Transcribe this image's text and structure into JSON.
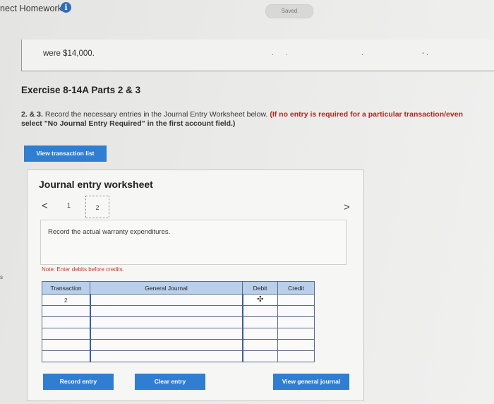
{
  "header": {
    "title": "nect Homework",
    "saved_label": "Saved"
  },
  "previous": {
    "text": "were $14,000."
  },
  "exercise": {
    "title": "Exercise 8-14A Parts 2 & 3",
    "instruction_lead": "2. & 3.",
    "instruction_main": " Record the necessary entries in the Journal Entry Worksheet below. ",
    "instruction_red": "(If no entry is required for a particular transaction/even",
    "instruction_line2": "select \"No Journal Entry Required\" in the first account field.)"
  },
  "view_transaction_label": "View transaction list",
  "worksheet": {
    "title": "Journal entry worksheet",
    "pages": [
      "1",
      "2"
    ],
    "current_page": "2",
    "prompt": "Record the actual warranty expenditures.",
    "note": "Note: Enter debits before credits.",
    "table": {
      "headers": [
        "Transaction",
        "General Journal",
        "Debit",
        "Credit"
      ],
      "rows": [
        {
          "transaction": "2",
          "account": "",
          "debit": "",
          "credit": ""
        },
        {
          "transaction": "",
          "account": "",
          "debit": "",
          "credit": ""
        },
        {
          "transaction": "",
          "account": "",
          "debit": "",
          "credit": ""
        },
        {
          "transaction": "",
          "account": "",
          "debit": "",
          "credit": ""
        },
        {
          "transaction": "",
          "account": "",
          "debit": "",
          "credit": ""
        },
        {
          "transaction": "",
          "account": "",
          "debit": "",
          "credit": ""
        }
      ]
    },
    "buttons": {
      "record": "Record entry",
      "clear": "Clear entry",
      "view_journal": "View general journal"
    }
  },
  "colors": {
    "primary_button": "#2f7ed1",
    "table_header": "#b9cfea",
    "info_icon": "#2f6db8",
    "note_red": "#c0392b"
  },
  "icons": {
    "info": "info-icon",
    "prev": "chevron-left-icon",
    "next": "chevron-right-icon",
    "cursor": "move-cursor-icon"
  }
}
